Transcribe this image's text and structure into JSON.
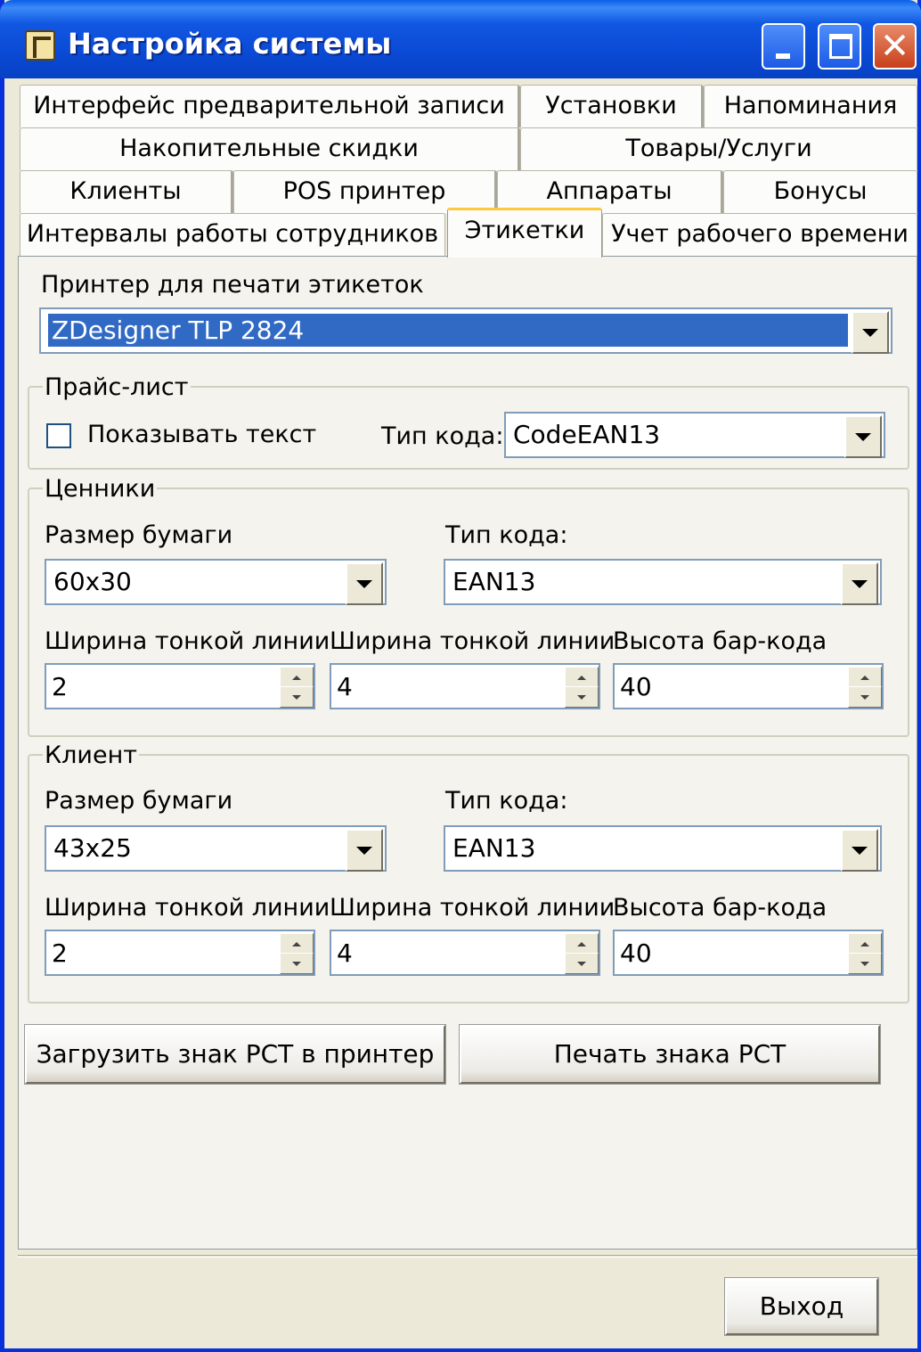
{
  "window": {
    "title": "Настройка системы"
  },
  "tabs": {
    "row1": [
      "Интерфейс предварительной записи",
      "Установки",
      "Напоминания"
    ],
    "row2": [
      "Накопительные скидки",
      "Товары/Услуги"
    ],
    "row3": [
      "Клиенты",
      "POS принтер",
      "Аппараты",
      "Бонусы"
    ],
    "row4": [
      "Интервалы работы сотрудников",
      "Этикетки",
      "Учет рабочего времени"
    ],
    "active": "Этикетки"
  },
  "printer": {
    "label": "Принтер для печати этикеток",
    "value": "ZDesigner TLP 2824"
  },
  "price_list": {
    "legend": "Прайс-лист",
    "show_text_label": "Показывать текст",
    "show_text_checked": false,
    "code_type_label": "Тип кода:",
    "code_type_value": "CodeEAN13"
  },
  "price_tags": {
    "legend": "Ценники",
    "paper_size_label": "Размер бумаги",
    "paper_size_value": "60x30",
    "code_type_label": "Тип кода:",
    "code_type_value": "EAN13",
    "line_width_label_1": "Ширина тонкой линии",
    "line_width_value_1": "2",
    "line_width_label_2": "Ширина тонкой линии",
    "line_width_value_2": "4",
    "barcode_height_label": "Высота бар-кода",
    "barcode_height_value": "40"
  },
  "client": {
    "legend": "Клиент",
    "paper_size_label": "Размер бумаги",
    "paper_size_value": "43x25",
    "code_type_label": "Тип кода:",
    "code_type_value": "EAN13",
    "line_width_label_1": "Ширина тонкой линии",
    "line_width_value_1": "2",
    "line_width_label_2": "Ширина тонкой линии",
    "line_width_value_2": "4",
    "barcode_height_label": "Высота бар-кода",
    "barcode_height_value": "40"
  },
  "buttons": {
    "load_pct": "Загрузить знак РСТ в принтер",
    "print_pct": "Печать знака РСТ",
    "exit": "Выход"
  }
}
